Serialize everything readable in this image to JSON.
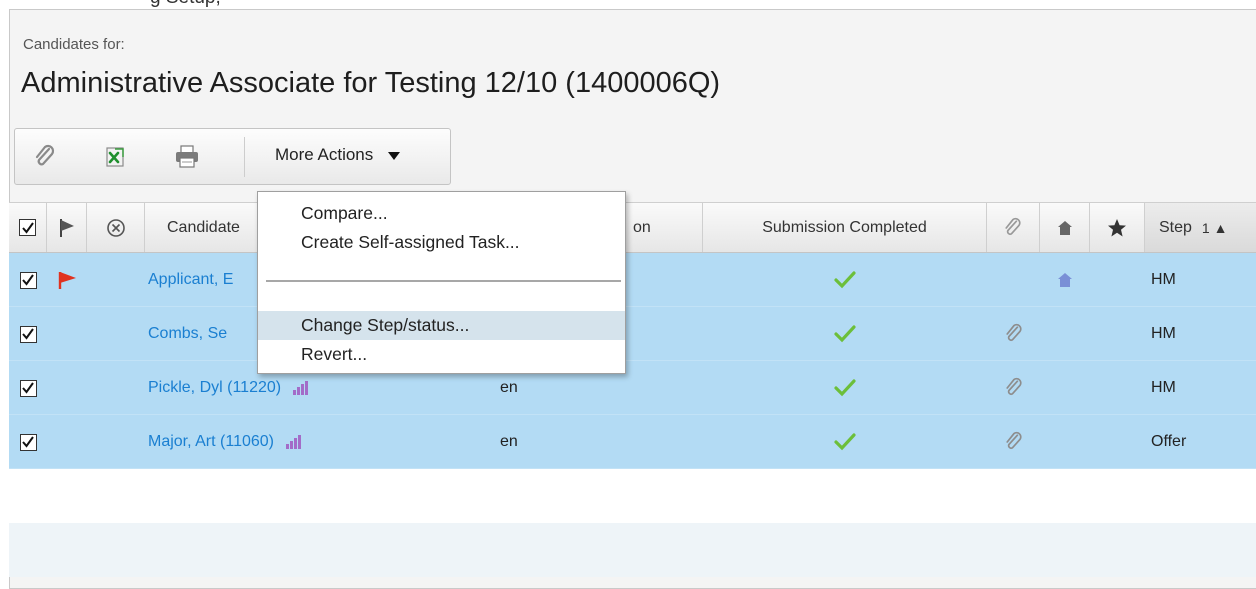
{
  "top_fragment": "g Setup,",
  "header": {
    "subtitle": "Candidates for:",
    "title": "Administrative Associate for Testing 12/10 (1400006Q)"
  },
  "toolbar": {
    "icons": [
      "paperclip-icon",
      "excel-export-icon",
      "printer-icon"
    ],
    "more_actions_label": "More Actions"
  },
  "table": {
    "columns": {
      "candidate": "Candidate",
      "language_tail": "on",
      "submission_completed": "Submission Completed",
      "step": "Step",
      "step_sort": "1 ▲"
    },
    "rows": [
      {
        "name": "Applicant, E",
        "language": "",
        "flag": true,
        "completed": true,
        "attachment": false,
        "house": true,
        "step": "HM"
      },
      {
        "name": "Combs, Se",
        "language": "",
        "flag": false,
        "completed": true,
        "attachment": true,
        "house": false,
        "step": "HM"
      },
      {
        "name": "Pickle, Dyl (11220)",
        "language": "en",
        "flag": false,
        "completed": true,
        "attachment": true,
        "house": false,
        "step": "HM"
      },
      {
        "name": "Major, Art (11060)",
        "language": "en",
        "flag": false,
        "completed": true,
        "attachment": true,
        "house": false,
        "step": "Offer"
      }
    ]
  },
  "dropdown": {
    "items": [
      "Compare...",
      "Create Self-assigned Task...",
      "Change Step/status...",
      "Revert..."
    ],
    "highlighted_index": 2
  },
  "colors": {
    "row_selected": "#b3dbf4",
    "link": "#1a7fd1",
    "flag": "#e0321f",
    "check": "#6cbf3a",
    "house": "#7a8fd6",
    "bars": "#a36cc8"
  }
}
